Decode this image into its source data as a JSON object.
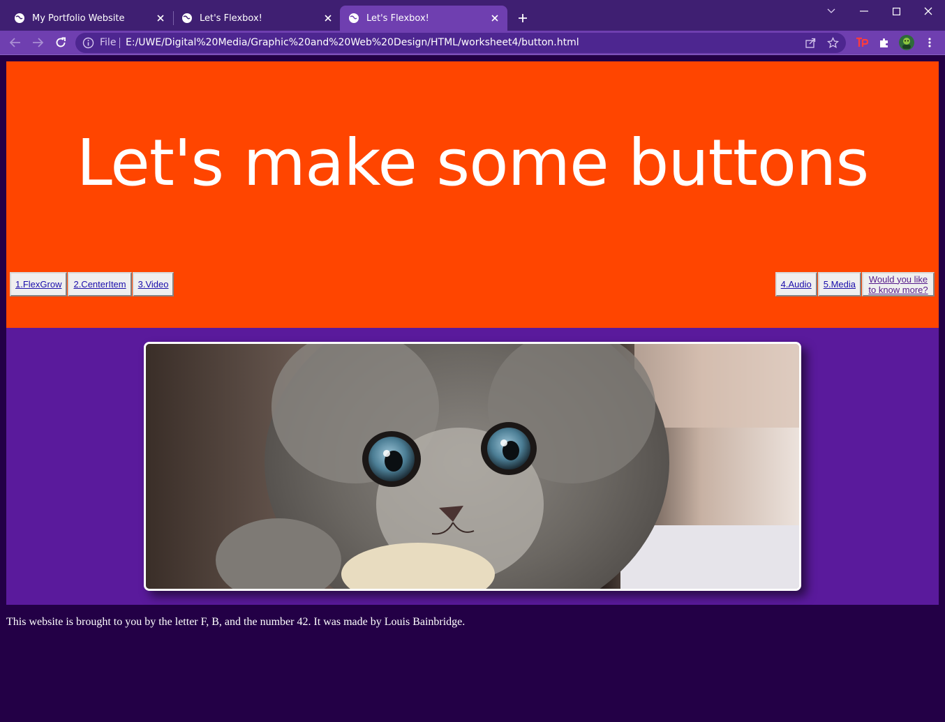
{
  "browser": {
    "tabs": [
      {
        "title": "My Portfolio Website",
        "active": false
      },
      {
        "title": "Let's Flexbox!",
        "active": false
      },
      {
        "title": "Let's Flexbox!",
        "active": true
      }
    ],
    "address": {
      "scheme_label": "File",
      "url": "E:/UWE/Digital%20Media/Graphic%20and%20Web%20Design/HTML/worksheet4/button.html"
    },
    "icons": {
      "back": "back-arrow-icon",
      "forward": "forward-arrow-icon",
      "reload": "reload-icon",
      "share": "share-icon",
      "bookmark": "star-icon",
      "extension_tp": "tp-extension-icon",
      "extensions": "puzzle-icon",
      "profile": "avatar",
      "menu": "kebab-menu-icon"
    },
    "accent": "#6f3fb0",
    "frame": "#3f1f72"
  },
  "page": {
    "heading": "Let's make some buttons",
    "buttons_left": [
      {
        "label": "1.FlexGrow"
      },
      {
        "label": "2.CenterItem"
      },
      {
        "label": "3.Video"
      }
    ],
    "buttons_right": [
      {
        "label": "4.Audio"
      },
      {
        "label": "5.Media"
      },
      {
        "label": "Would you like to know more?"
      }
    ],
    "hero_color": "#ff4500",
    "media_color": "#5a1a9c",
    "background_color": "#230046",
    "image": {
      "subject": "kitten",
      "description": "Close-up photo of a grey fluffy kitten"
    },
    "footer": "This website is brought to you by the letter F, B, and the number 42. It was made by Louis Bainbridge."
  }
}
